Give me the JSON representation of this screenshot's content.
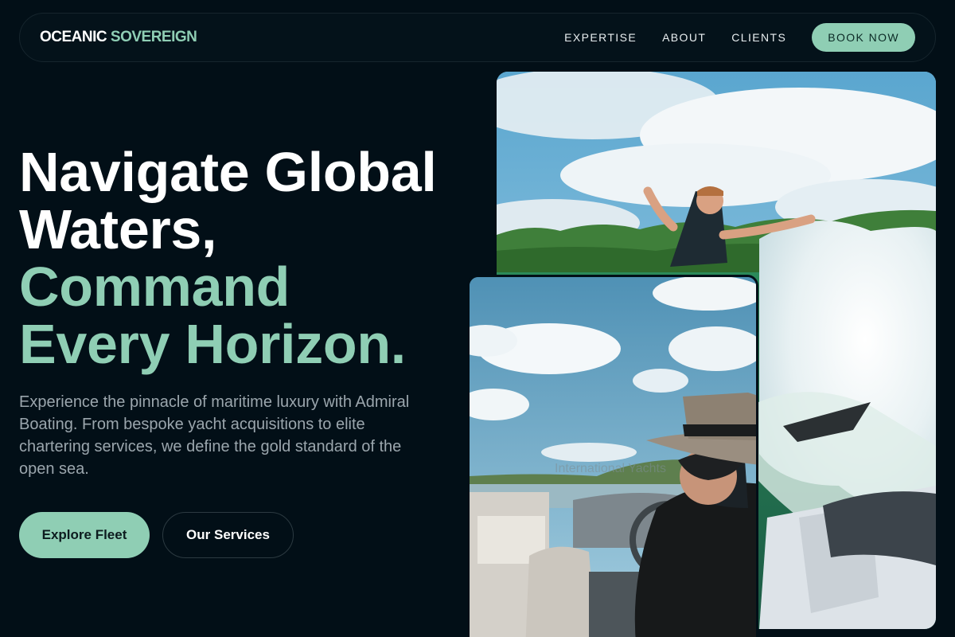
{
  "nav": {
    "brand_part1": "OCEANIC",
    "brand_part2": "SOVEREIGN",
    "links": [
      "EXPERTISE",
      "ABOUT",
      "CLIENTS"
    ],
    "cta": "BOOK NOW"
  },
  "hero": {
    "title_lines": [
      "Navigate Global",
      "Waters,"
    ],
    "title_accent_lines": [
      "Command",
      "Every Horizon."
    ],
    "lead": "Experience the pinnacle of maritime luxury with Admiral Boating. From bespoke yacht acquisitions to elite chartering services, we define the gold standard of the open sea.",
    "primary_button": "Explore Fleet",
    "secondary_button": "Our Services"
  },
  "images": {
    "back": "wakesurfer-photo",
    "front": "boat-driver-photo",
    "front_watermark": "International Yachts"
  },
  "colors": {
    "background": "#020f17",
    "accent": "#8fceb4",
    "muted_text": "#9ba6ad"
  }
}
